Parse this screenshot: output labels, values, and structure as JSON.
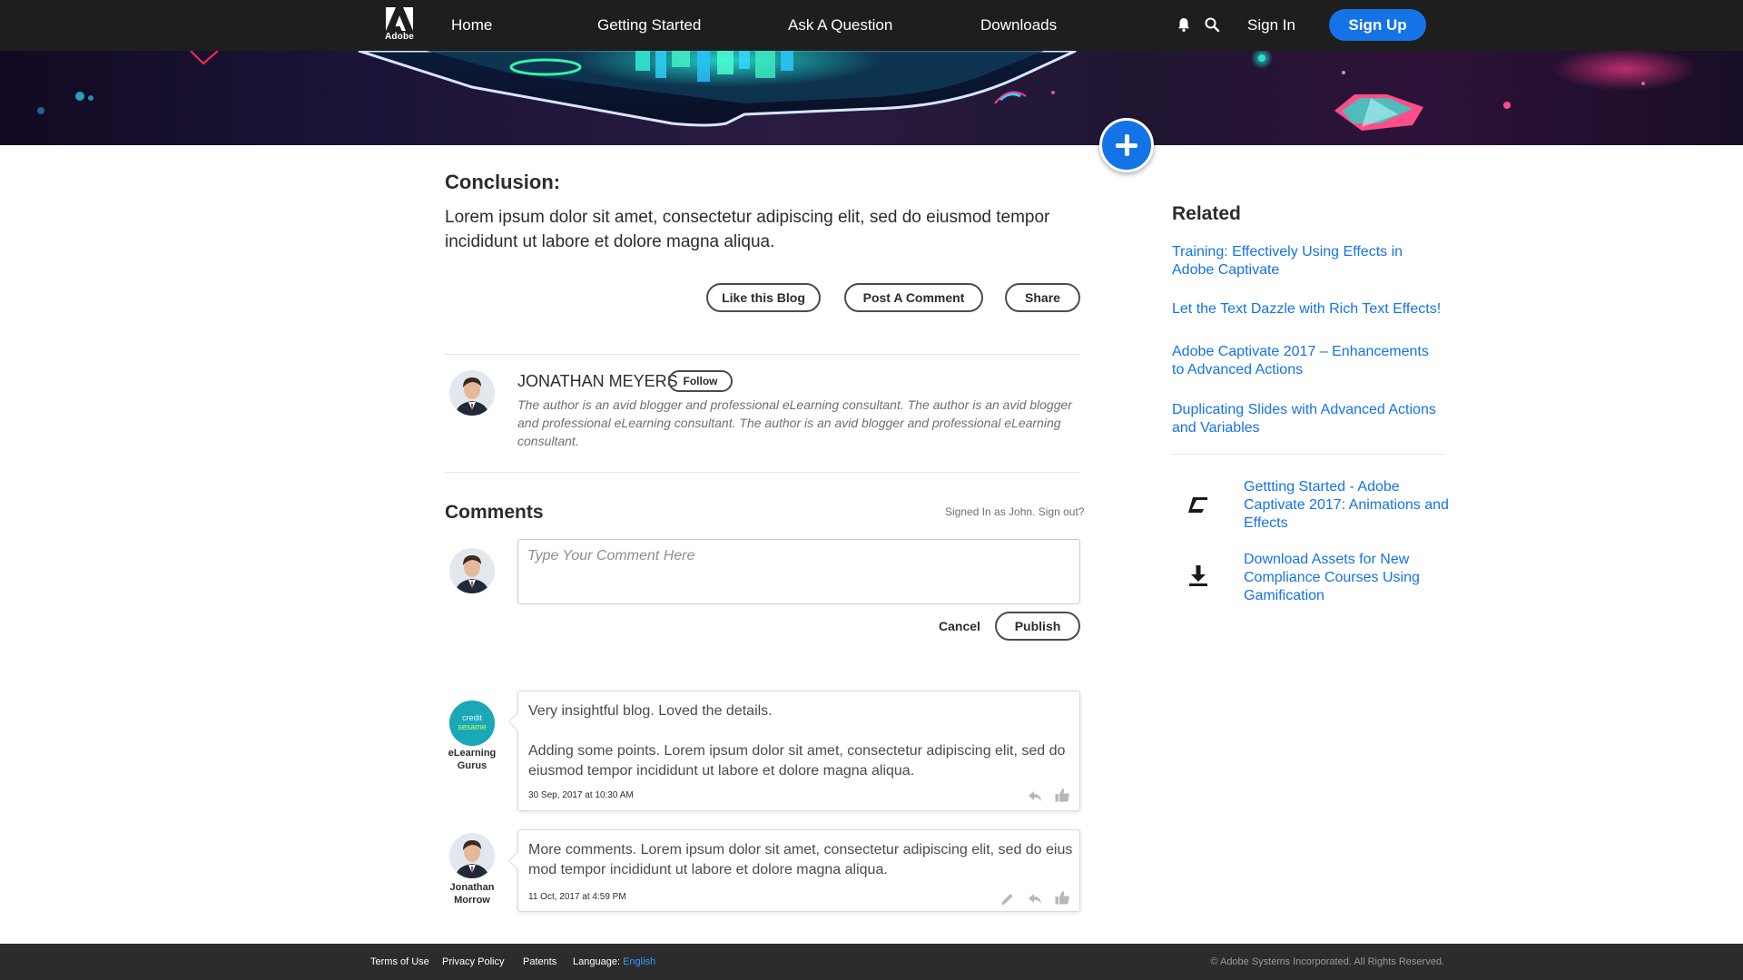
{
  "nav": {
    "logo_text": "Adobe",
    "links": [
      "Home",
      "Getting Started",
      "Ask A Question",
      "Downloads"
    ],
    "icons": [
      "bell-icon",
      "search-icon"
    ],
    "sign_in": "Sign In",
    "sign_up": "Sign Up"
  },
  "banner": {
    "fab_icon": "plus-icon"
  },
  "article": {
    "heading": "Conclusion:",
    "body": "Lorem ipsum dolor sit amet, consectetur adipiscing elit, sed do eiusmod tempor incididunt ut labore et dolore magna aliqua.",
    "actions": [
      "Like this Blog",
      "Post A Comment",
      "Share"
    ]
  },
  "author": {
    "name": "JONATHAN MEYERS",
    "follow": "Follow",
    "bio": "The author is an avid blogger and professional eLearning consultant. The author is an avid blogger and professional eLearning consultant. The author is an avid blogger and professional eLearning consultant."
  },
  "comments": {
    "heading": "Comments",
    "signed_in": "Signed In as John. Sign out?",
    "placeholder": "Type Your Comment Here",
    "cancel": "Cancel",
    "publish": "Publish",
    "items": [
      {
        "author": "eLearning Gurus",
        "avatar_text": "credit sesame",
        "text_1": "Very insightful blog. Loved the details.",
        "text_2": "Adding some points. Lorem ipsum dolor sit amet, consectetur adipiscing elit, sed do eiusmod tempor incididunt ut labore et dolore magna aliqua.",
        "date": "30 Sep, 2017 at 10:30 AM",
        "icons": [
          "reply-icon",
          "thumbs-up-icon"
        ]
      },
      {
        "author": "Jonathan Morrow",
        "text_1": "More comments. Lorem ipsum dolor sit amet, consectetur adipiscing elit, sed do eius mod tempor incididunt ut labore et dolore magna aliqua.",
        "date": "11 Oct, 2017 at 4:59 PM",
        "icons": [
          "edit-pencil-icon",
          "reply-icon",
          "thumbs-up-icon"
        ]
      }
    ]
  },
  "related": {
    "heading": "Related",
    "links": [
      "Training: Effectively Using Effects in Adobe Captivate",
      "Let the Text Dazzle with Rich Text Effects!",
      "Adobe Captivate 2017 – Enhancements to Advanced Actions",
      "Duplicating Slides with Advanced Actions and Variables"
    ],
    "resources": [
      {
        "icon": "eraser-icon",
        "label": "Gettting Started - Adobe Captivate 2017: Animations and Effects"
      },
      {
        "icon": "download-icon",
        "label": "Download Assets for New Compliance Courses Using Gamification"
      }
    ]
  },
  "footer": {
    "links": [
      "Terms of Use",
      "Privacy Policy",
      "Patents"
    ],
    "language_label": "Language:",
    "language_value": "English",
    "copyright": "© Adobe Systems Incorporated. All Rights Reserved."
  }
}
